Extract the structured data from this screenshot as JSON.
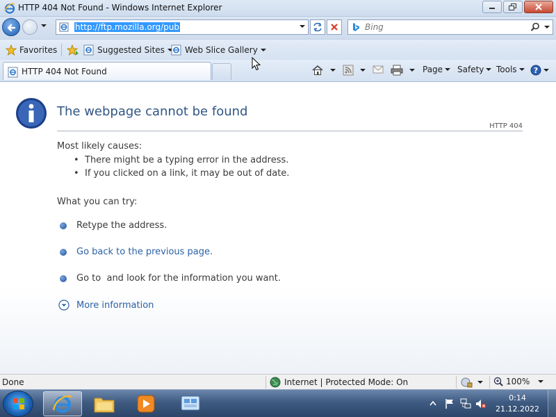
{
  "window": {
    "title": "HTTP 404 Not Found - Windows Internet Explorer"
  },
  "navigation": {
    "address_url": "http://ftp.mozilla.org/pub",
    "search_placeholder": "Bing"
  },
  "favorites_bar": {
    "favorites_label": "Favorites",
    "suggested_sites_label": "Suggested Sites",
    "web_slice_gallery_label": "Web Slice Gallery"
  },
  "command_bar": {
    "tab_title": "HTTP 404 Not Found",
    "page_label": "Page",
    "safety_label": "Safety",
    "tools_label": "Tools"
  },
  "error_page": {
    "title": "The webpage cannot be found",
    "code": "HTTP 404",
    "causes_heading": "Most likely causes:",
    "causes": [
      "There might be a typing error in the address.",
      "If you clicked on a link, it may be out of date."
    ],
    "try_heading": "What you can try:",
    "try_items": [
      "Retype the address.",
      "Go back to the previous page.",
      "Go to  and look for the information you want."
    ],
    "more_info": "More information"
  },
  "status_bar": {
    "status": "Done",
    "zone": "Internet | Protected Mode: On",
    "zoom": "100%"
  },
  "taskbar": {
    "time": "0:14",
    "date": "21.12.2022"
  },
  "colors": {
    "title_text": "#2f5585",
    "link": "#2b61a3",
    "url_highlight": "#3399ff"
  }
}
